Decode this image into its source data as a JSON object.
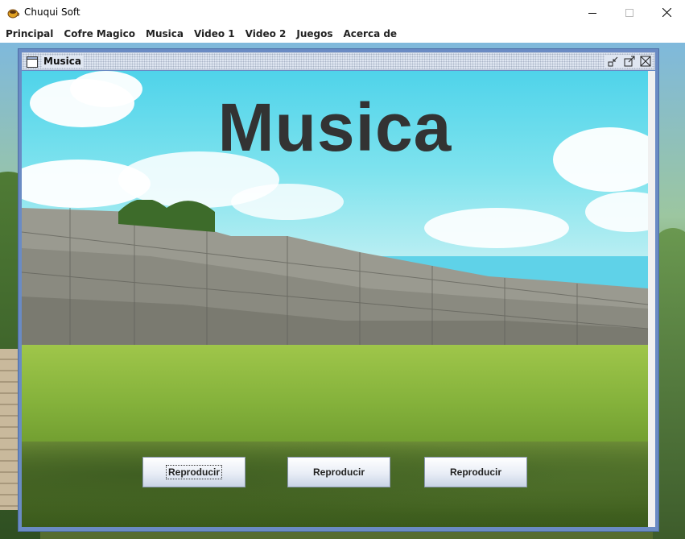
{
  "window": {
    "title": "Chuqui Soft",
    "icon": "coffee-cup-icon",
    "controls": [
      "minimize-icon",
      "maximize-icon",
      "close-icon"
    ]
  },
  "menubar": {
    "items": [
      {
        "label": "Principal"
      },
      {
        "label": "Cofre Magico"
      },
      {
        "label": "Musica"
      },
      {
        "label": "Video 1"
      },
      {
        "label": "Video 2"
      },
      {
        "label": "Juegos"
      },
      {
        "label": "Acerca de"
      }
    ]
  },
  "internal_frame": {
    "title": "Musica",
    "icon": "window-icon",
    "controls": [
      "iconify-icon",
      "maximize-icon",
      "close-icon"
    ],
    "heading": "Musica",
    "buttons": [
      {
        "label": "Reproducir",
        "focused": true
      },
      {
        "label": "Reproducir",
        "focused": false
      },
      {
        "label": "Reproducir",
        "focused": false
      }
    ]
  },
  "colors": {
    "frame_border": "#6a8bc4",
    "heading": "#333333",
    "sky": "#4fd3ea",
    "grass": "#86b33c"
  }
}
